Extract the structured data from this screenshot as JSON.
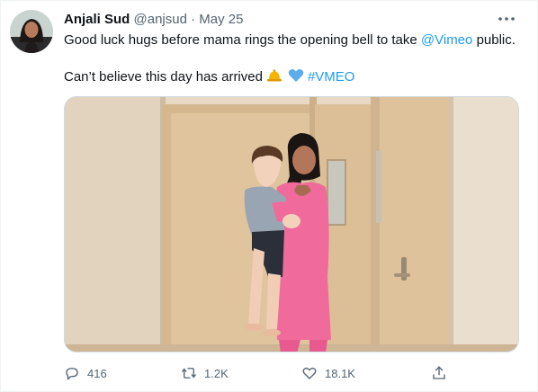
{
  "tweet": {
    "author_name": "Anjali Sud",
    "handle": "@anjsud",
    "separator": "·",
    "date": "May 25",
    "line1_prefix": "Good luck hugs before mama rings the opening bell to take ",
    "line1_mention": "@Vimeo",
    "line1_suffix": " public.",
    "line2_text": "Can’t believe this day has arrived",
    "line2_hashtag": "#VMEO",
    "emojis": [
      "bell-emoji",
      "blue-heart-emoji"
    ]
  },
  "actions": {
    "reply_count": "416",
    "retweet_count": "1.2K",
    "like_count": "18.1K"
  },
  "colors": {
    "link": "#1d9bf0",
    "secondary_text": "#536471",
    "outfit_pink": "#f06a9c"
  }
}
